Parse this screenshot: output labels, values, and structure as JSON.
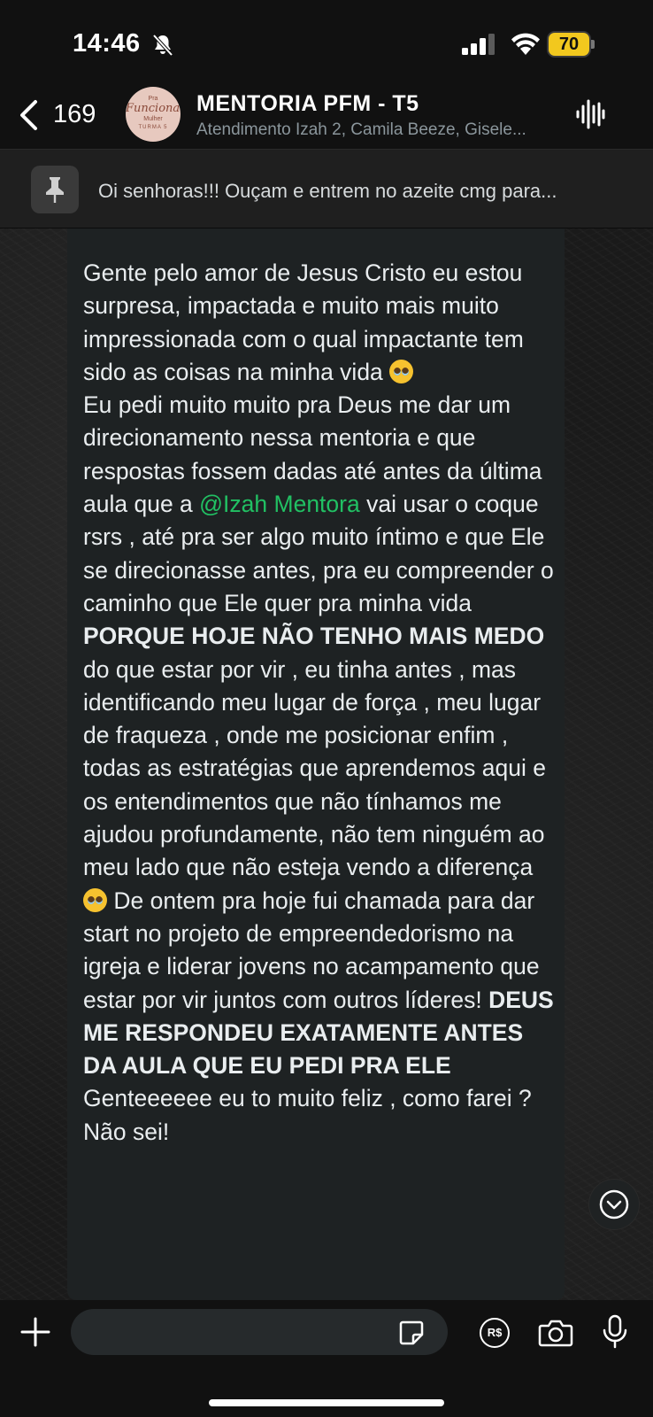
{
  "status_bar": {
    "time": "14:46",
    "battery": "70",
    "battery_color": "#f2c81e"
  },
  "header": {
    "back_count": "169",
    "title": "MENTORIA PFM - T5",
    "subtitle": "Atendimento Izah 2, Camila Beeze, Gisele...",
    "avatar": {
      "line1": "Pra",
      "line2": "Funcionar",
      "line3": "Mulher",
      "line4": "TURMA 5"
    }
  },
  "pinned": {
    "text": "Oi senhoras!!! Ouçam e entrem no azeite cmg para..."
  },
  "message": {
    "p1": "Gente pelo amor de Jesus Cristo eu estou surpresa, impactada e muito mais muito impressionada com o qual impactante tem sido as coisas na minha vida",
    "p2": "Eu pedi muito muito pra Deus me dar um direcionamento nessa mentoria e que respostas fossem dadas até antes da última aula que a",
    "mention": "@Izah Mentora",
    "p3": "vai usar o coque rsrs , até pra ser algo muito íntimo e que Ele se direcionasse antes,  pra eu compreender o caminho que Ele quer pra minha vida",
    "bold1": "PORQUE HOJE NÃO TENHO MAIS MEDO",
    "p4": "do que estar por vir , eu tinha antes , mas identificando meu lugar de força , meu lugar de fraqueza , onde me posicionar enfim , todas as estratégias que aprendemos aqui e os entendimentos que não tínhamos me ajudou profundamente, não tem ninguém ao meu lado que não esteja vendo a diferença",
    "p5": "De ontem pra hoje fui chamada para dar start no projeto de empreendedorismo na igreja e liderar jovens no acampamento que estar por vir juntos com outros líderes!",
    "bold2": "DEUS ME RESPONDEU EXATAMENTE ANTES DA AULA QUE EU PEDI PRA ELE",
    "p6": "Genteeeeee eu to muito feliz , como farei ? Não sei!"
  },
  "composer": {
    "placeholder": "",
    "pay_label": "R$"
  },
  "colors": {
    "mention": "#21c063",
    "bubble": "#1e2223"
  }
}
